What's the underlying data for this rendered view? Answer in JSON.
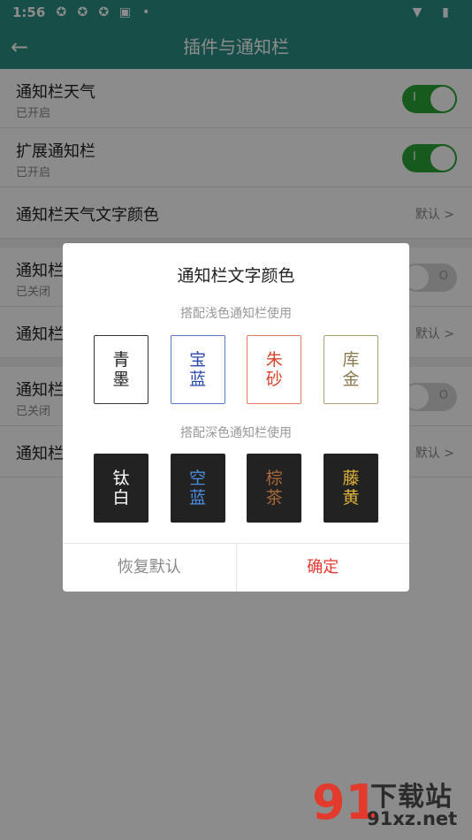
{
  "status_bar": {
    "time": "1:56",
    "icons": [
      "sync-icon",
      "sync-icon",
      "sync-icon",
      "a-badge-icon",
      "dot-icon"
    ],
    "right_icons": [
      "wifi-icon",
      "battery-icon"
    ]
  },
  "app_bar": {
    "back_icon": "arrow-left-icon",
    "title": "插件与通知栏"
  },
  "settings": {
    "row1": {
      "title": "通知栏天气",
      "subtitle": "已开启",
      "switch_on": true,
      "switch_mark": "I"
    },
    "row2": {
      "title": "扩展通知栏",
      "subtitle": "已开启",
      "switch_on": true,
      "switch_mark": "I"
    },
    "row3": {
      "title": "通知栏天气文字颜色",
      "value": "默认 >"
    },
    "row4": {
      "title": "通知栏",
      "subtitle": "已关闭",
      "switch_on": false,
      "switch_mark": "O"
    },
    "row5": {
      "title": "通知栏",
      "value": "默认 >"
    },
    "row6": {
      "title": "通知栏",
      "subtitle": "已关闭",
      "switch_on": false,
      "switch_mark": "O"
    },
    "row7": {
      "title": "通知栏",
      "value": "默认 >"
    }
  },
  "dialog": {
    "title": "通知栏文字颜色",
    "light_label": "搭配浅色通知栏使用",
    "dark_label": "搭配深色通知栏使用",
    "light_swatches": [
      {
        "label": "青墨",
        "color": "#222222",
        "border": "#333333",
        "bg": "#ffffff"
      },
      {
        "label": "宝蓝",
        "color": "#2a48b0",
        "border": "#5a78c8",
        "bg": "#ffffff"
      },
      {
        "label": "朱砂",
        "color": "#d8452f",
        "border": "#e07a66",
        "bg": "#ffffff"
      },
      {
        "label": "库金",
        "color": "#8a7a52",
        "border": "#b0a17a",
        "bg": "#ffffff"
      }
    ],
    "dark_swatches": [
      {
        "label": "钛白",
        "color": "#ffffff",
        "border": "#222222",
        "bg": "#222222"
      },
      {
        "label": "空蓝",
        "color": "#4a8fe0",
        "border": "#222222",
        "bg": "#222222"
      },
      {
        "label": "棕茶",
        "color": "#a8683a",
        "border": "#222222",
        "bg": "#222222"
      },
      {
        "label": "藤黄",
        "color": "#e0b43a",
        "border": "#222222",
        "bg": "#222222"
      }
    ],
    "cancel_label": "恢复默认",
    "confirm_label": "确定"
  },
  "watermark": {
    "logo": "91",
    "cn": "下载站",
    "en": "91xz.net"
  }
}
